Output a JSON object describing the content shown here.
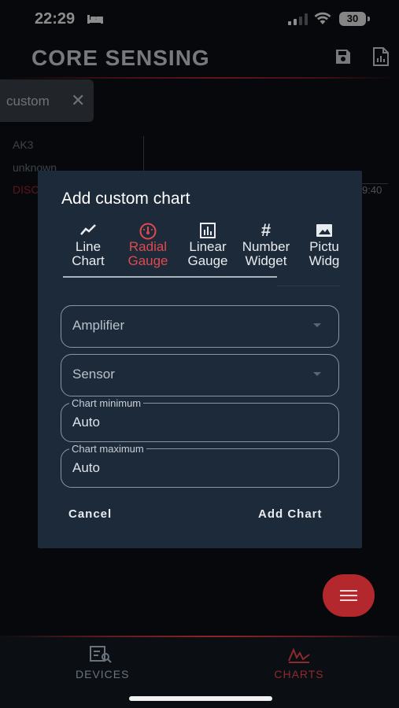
{
  "status_bar": {
    "time": "22:29",
    "battery": "30"
  },
  "app": {
    "logo": "CORE SENSING"
  },
  "filter_chip": {
    "label": "custom"
  },
  "background_card": {
    "line1": "AK3",
    "line2": "unknown",
    "line3": "DISC",
    "time": "9:40"
  },
  "dialog": {
    "title": "Add custom chart",
    "tabs": [
      {
        "line1": "Line",
        "line2": "Chart",
        "icon": "line-chart-icon"
      },
      {
        "line1": "Radial",
        "line2": "Gauge",
        "icon": "radial-gauge-icon"
      },
      {
        "line1": "Linear",
        "line2": "Gauge",
        "icon": "linear-gauge-icon"
      },
      {
        "line1": "Number",
        "line2": "Widget",
        "icon": "hash-icon"
      },
      {
        "line1": "Pictu",
        "line2": "Widg",
        "icon": "image-icon"
      }
    ],
    "active_tab": "Radial Gauge",
    "amplifier": {
      "placeholder": "Amplifier"
    },
    "sensor": {
      "placeholder": "Sensor"
    },
    "chart_minimum": {
      "label": "Chart minimum",
      "value": "Auto"
    },
    "chart_maximum": {
      "label": "Chart maximum",
      "value": "Auto"
    },
    "cancel_label": "Cancel",
    "add_label": "Add Chart"
  },
  "nav": {
    "devices": "DEVICES",
    "charts": "CHARTS"
  },
  "colors": {
    "accent": "#e04a4d",
    "dialog_bg": "#1d2a3a",
    "app_bg": "#0b0f14"
  }
}
